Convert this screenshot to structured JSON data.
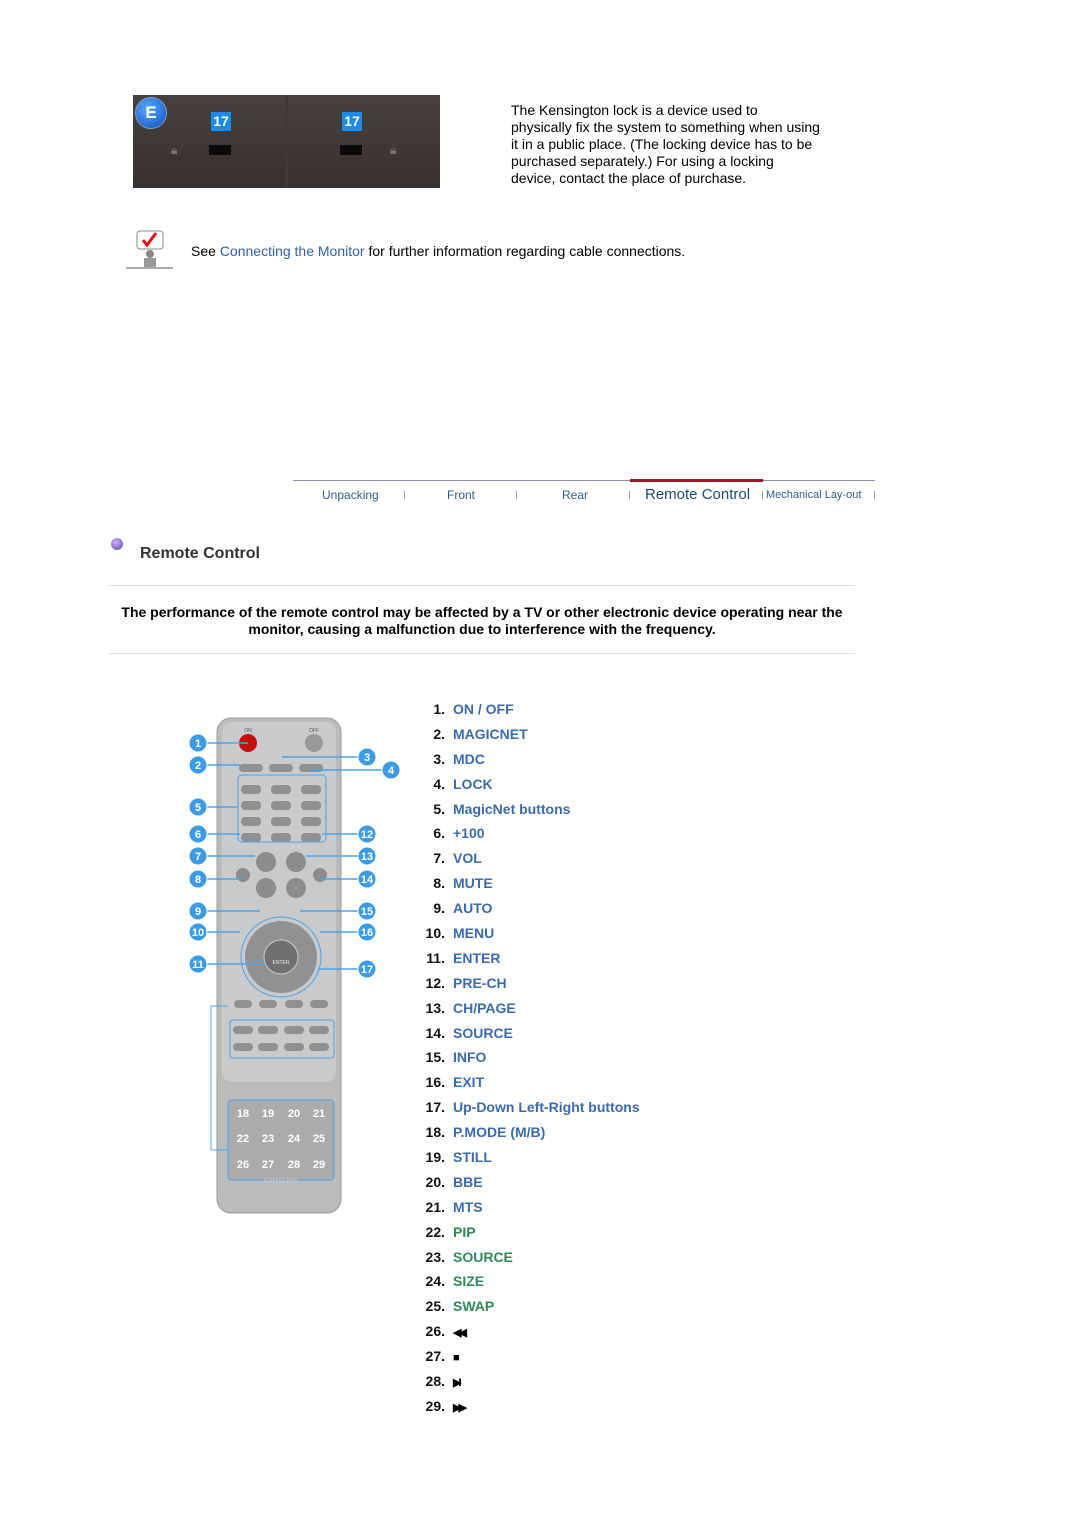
{
  "kensington": {
    "badge": "E",
    "tag_left": "17",
    "tag_right": "17",
    "description": "The Kensington lock is a device used to physically fix the system to something when using it in a public place. (The locking device has to be purchased separately.) For using a locking device, contact the place of purchase."
  },
  "note": {
    "prefix": "See ",
    "link": "Connecting the Monitor",
    "suffix": " for further information regarding cable connections."
  },
  "tabs": [
    {
      "label": "Unpacking"
    },
    {
      "label": "Front"
    },
    {
      "label": "Rear"
    },
    {
      "label": "Remote Control",
      "active": true
    },
    {
      "label": "Mechanical Lay-out"
    }
  ],
  "section": {
    "title": "Remote Control"
  },
  "warning": "The performance of the remote control may be affected by a TV or other electronic device operating near the monitor, causing a malfunction due to interference with the frequency.",
  "colors": {
    "link": "#3a6bb0",
    "green_items": "#2e8b57",
    "active_tab": "#9b1b22",
    "callout": "#4aa3ea"
  },
  "remote": {
    "callouts": [
      "1",
      "2",
      "3",
      "4",
      "5",
      "6",
      "7",
      "8",
      "9",
      "10",
      "11",
      "12",
      "13",
      "14",
      "15",
      "16",
      "17"
    ],
    "bottom_buttons": [
      "18",
      "19",
      "20",
      "21",
      "22",
      "23",
      "24",
      "25",
      "26",
      "27",
      "28",
      "29"
    ],
    "labels": {
      "on": "ON",
      "off": "OFF",
      "enter": "ENTER",
      "brand": "SAMSUNG"
    }
  },
  "items": [
    {
      "num": "1.",
      "label": "ON / OFF"
    },
    {
      "num": "2.",
      "label": "MAGICNET"
    },
    {
      "num": "3.",
      "label": "MDC"
    },
    {
      "num": "4.",
      "label": "LOCK"
    },
    {
      "num": "5.",
      "label": "MagicNet buttons"
    },
    {
      "num": "6.",
      "label": "+100"
    },
    {
      "num": "7.",
      "label": "VOL"
    },
    {
      "num": "8.",
      "label": "MUTE"
    },
    {
      "num": "9.",
      "label": "AUTO"
    },
    {
      "num": "10.",
      "label": "MENU"
    },
    {
      "num": "11.",
      "label": "ENTER"
    },
    {
      "num": "12.",
      "label": "PRE-CH"
    },
    {
      "num": "13.",
      "label": "CH/PAGE"
    },
    {
      "num": "14.",
      "label": "SOURCE"
    },
    {
      "num": "15.",
      "label": "INFO"
    },
    {
      "num": "16.",
      "label": "EXIT"
    },
    {
      "num": "17.",
      "label": "Up-Down Left-Right buttons"
    },
    {
      "num": "18.",
      "label": "P.MODE (M/B)"
    },
    {
      "num": "19.",
      "label": "STILL"
    },
    {
      "num": "20.",
      "label": "BBE"
    },
    {
      "num": "21.",
      "label": "MTS"
    },
    {
      "num": "22.",
      "label": "PIP",
      "color": "green"
    },
    {
      "num": "23.",
      "label": "SOURCE",
      "color": "green"
    },
    {
      "num": "24.",
      "label": "SIZE",
      "color": "green"
    },
    {
      "num": "25.",
      "label": "SWAP",
      "color": "green"
    },
    {
      "num": "26.",
      "icon": "rewind-icon",
      "label": "◀◀"
    },
    {
      "num": "27.",
      "icon": "stop-icon",
      "label": "■"
    },
    {
      "num": "28.",
      "icon": "play-pause-icon",
      "label": "▶II"
    },
    {
      "num": "29.",
      "icon": "fast-forward-icon",
      "label": "▶▶"
    }
  ]
}
